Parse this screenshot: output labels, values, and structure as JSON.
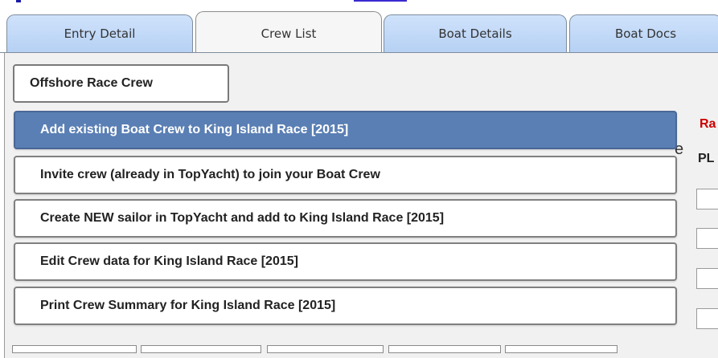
{
  "tabs": [
    {
      "label": "Entry Detail",
      "active": false
    },
    {
      "label": "Crew List",
      "active": true
    },
    {
      "label": "Boat Details",
      "active": false
    },
    {
      "label": "Boat Docs",
      "active": false
    }
  ],
  "section_button": {
    "label": "Offshore Race Crew"
  },
  "right_header": {
    "race_fragment": "Ra",
    "pl_fragment": "PL",
    "e_fragment": "e"
  },
  "menu": {
    "items": [
      {
        "label": "Add existing Boat Crew to King Island Race [2015]",
        "highlighted": true
      },
      {
        "label": "Invite crew (already in TopYacht) to join your Boat Crew",
        "highlighted": false
      },
      {
        "label": "Create NEW sailor in TopYacht and add to King Island Race [2015]",
        "highlighted": false
      },
      {
        "label": "Edit Crew data for King Island Race [2015]",
        "highlighted": false
      },
      {
        "label": "Print Crew Summary for King Island Race [2015]",
        "highlighted": false
      }
    ]
  },
  "colors": {
    "tab_blue": "#b6d1f4",
    "highlight_blue": "#5a7fb4",
    "race_red": "#cc0000"
  }
}
